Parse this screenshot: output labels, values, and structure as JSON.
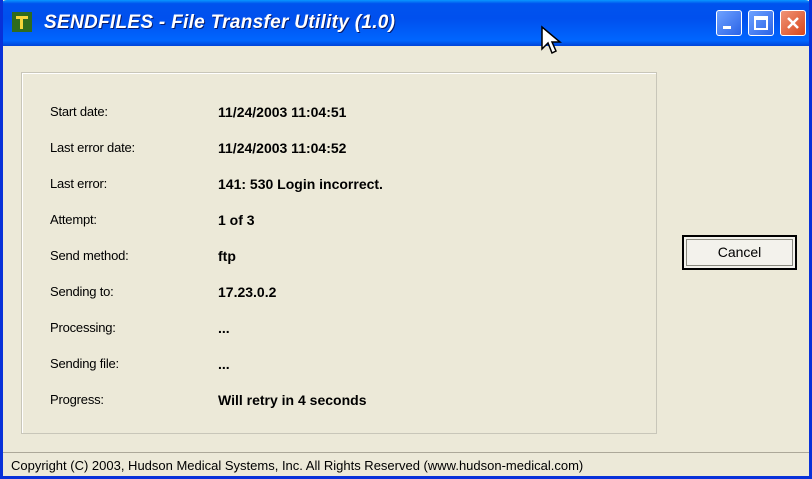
{
  "window": {
    "title": "SENDFILES - File Transfer Utility (1.0)",
    "icon": "app-icon"
  },
  "status": {
    "rows": [
      {
        "label": "Start date:",
        "value": "11/24/2003  11:04:51"
      },
      {
        "label": "Last error date:",
        "value": "11/24/2003  11:04:52"
      },
      {
        "label": "Last error:",
        "value": "141: 530 Login incorrect."
      },
      {
        "label": "Attempt:",
        "value": "1 of 3"
      },
      {
        "label": "Send method:",
        "value": "ftp"
      },
      {
        "label": "Sending to:",
        "value": "17.23.0.2"
      },
      {
        "label": "Processing:",
        "value": "..."
      },
      {
        "label": "Sending file:",
        "value": "..."
      },
      {
        "label": "Progress:",
        "value": "Will retry in 4 seconds"
      }
    ]
  },
  "buttons": {
    "cancel_label": "Cancel"
  },
  "footer": {
    "copyright": "Copyright (C) 2003, Hudson Medical Systems, Inc.  All Rights Reserved  (www.hudson-medical.com)"
  },
  "colors": {
    "titlebar": "#0054e3",
    "window_bg": "#ece9d8",
    "close_button": "#d8461a"
  }
}
